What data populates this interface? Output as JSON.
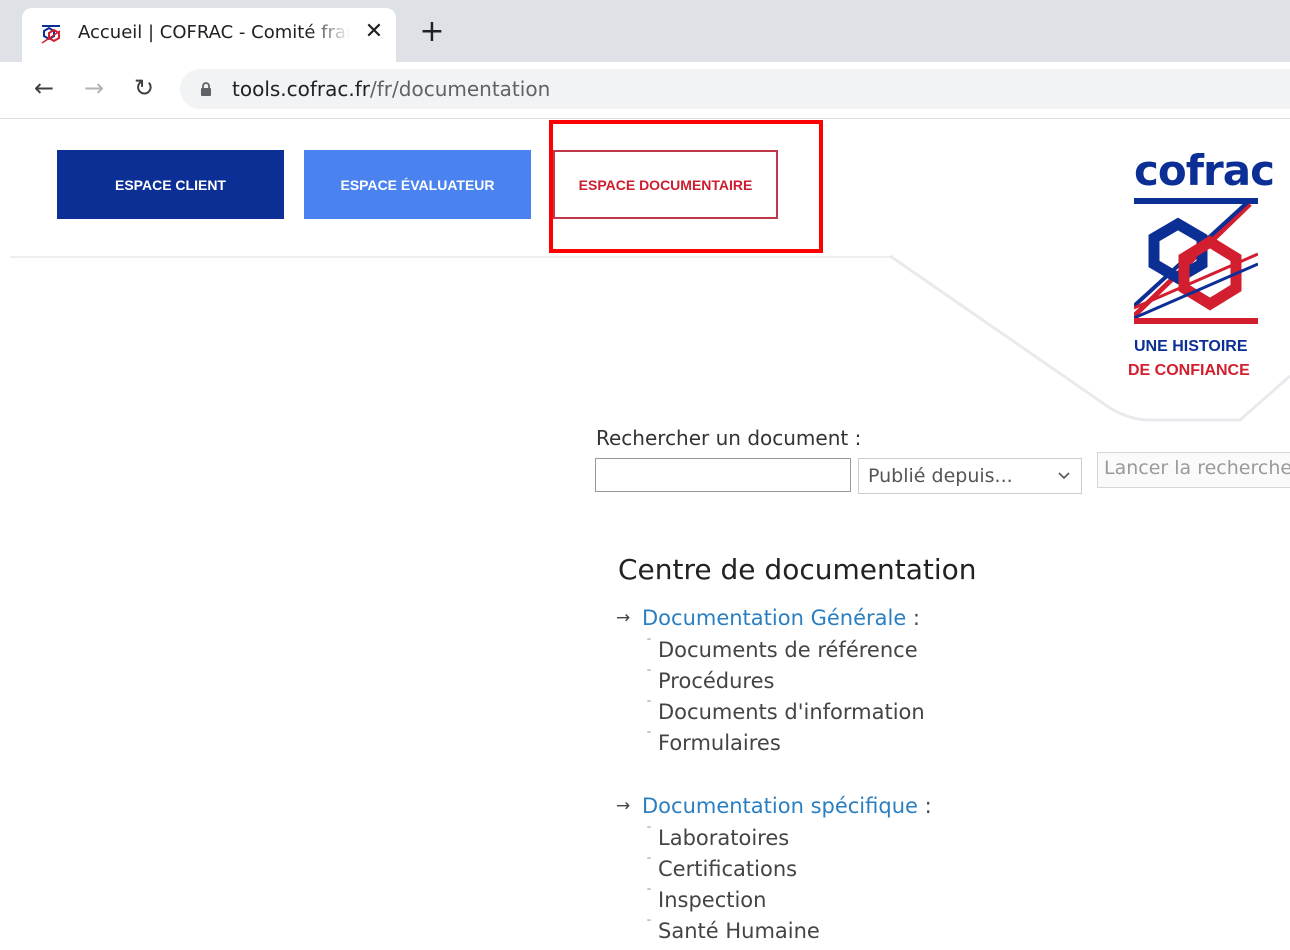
{
  "browser": {
    "tab_title": "Accueil | COFRAC - Comité français d'accréditation",
    "url_host": "tools.cofrac.fr",
    "url_path": "/fr/documentation"
  },
  "nav": {
    "client": "ESPACE CLIENT",
    "evaluateur": "ESPACE ÉVALUATEUR",
    "documentaire": "ESPACE DOCUMENTAIRE"
  },
  "logo": {
    "word": "cofrac",
    "tagline_1": "UNE HISTOIRE",
    "tagline_2": "DE CONFIANCE"
  },
  "search": {
    "label": "Rechercher un document :",
    "input_value": "",
    "select_value": "Publié depuis...",
    "button": "Lancer la recherche"
  },
  "documentation": {
    "title": "Centre de documentation",
    "sections": [
      {
        "label": "Documentation Générale",
        "suffix": " :",
        "items": [
          "Documents de référence",
          "Procédures",
          "Documents d'information",
          "Formulaires"
        ]
      },
      {
        "label": "Documentation spécifique",
        "suffix": " :",
        "items": [
          "Laboratoires",
          "Certifications",
          "Inspection",
          "Santé Humaine"
        ]
      }
    ]
  },
  "colors": {
    "brand_blue": "#0c2f96",
    "light_blue": "#4a83f0",
    "brand_red": "#d21e2e",
    "link": "#2a7fc2",
    "highlight": "#ff0000"
  }
}
